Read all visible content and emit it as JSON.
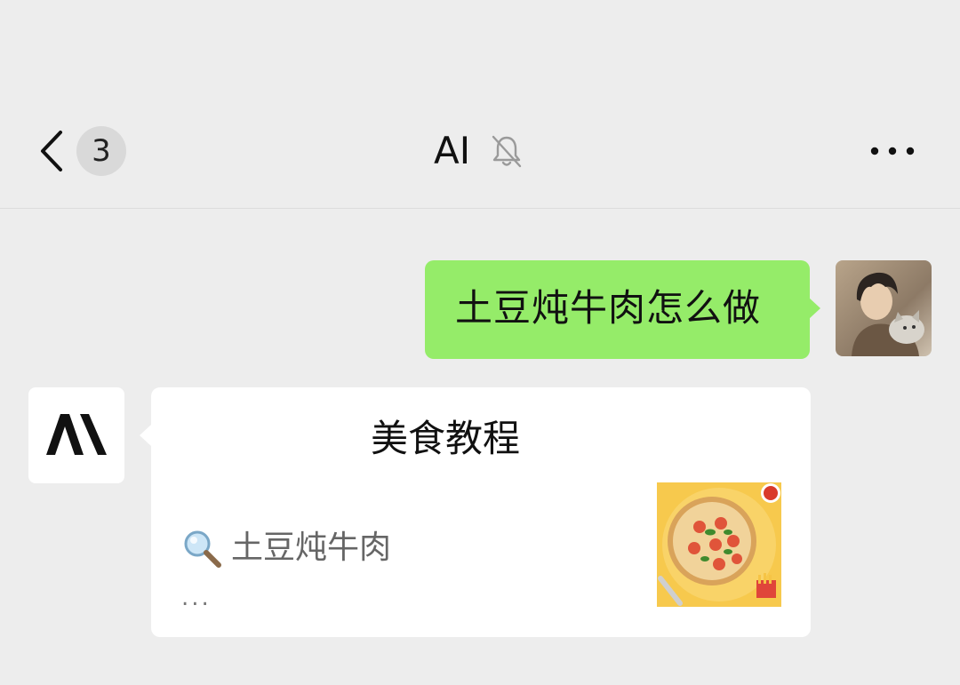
{
  "nav": {
    "unread_count": "3",
    "title": "AI",
    "mute_icon": "bell-muted-icon",
    "back_icon": "chevron-left-icon",
    "more_icon": "more-horizontal-icon"
  },
  "messages": {
    "outgoing": {
      "text": "土豆炖牛肉怎么做"
    },
    "incoming_card": {
      "title": "美食教程",
      "search_text": "土豆炖牛肉",
      "ellipsis": "...",
      "thumbnail": "pizza-thumbnail"
    }
  },
  "colors": {
    "background": "#ededed",
    "outgoing_bubble": "#95ec69",
    "card": "#ffffff"
  }
}
